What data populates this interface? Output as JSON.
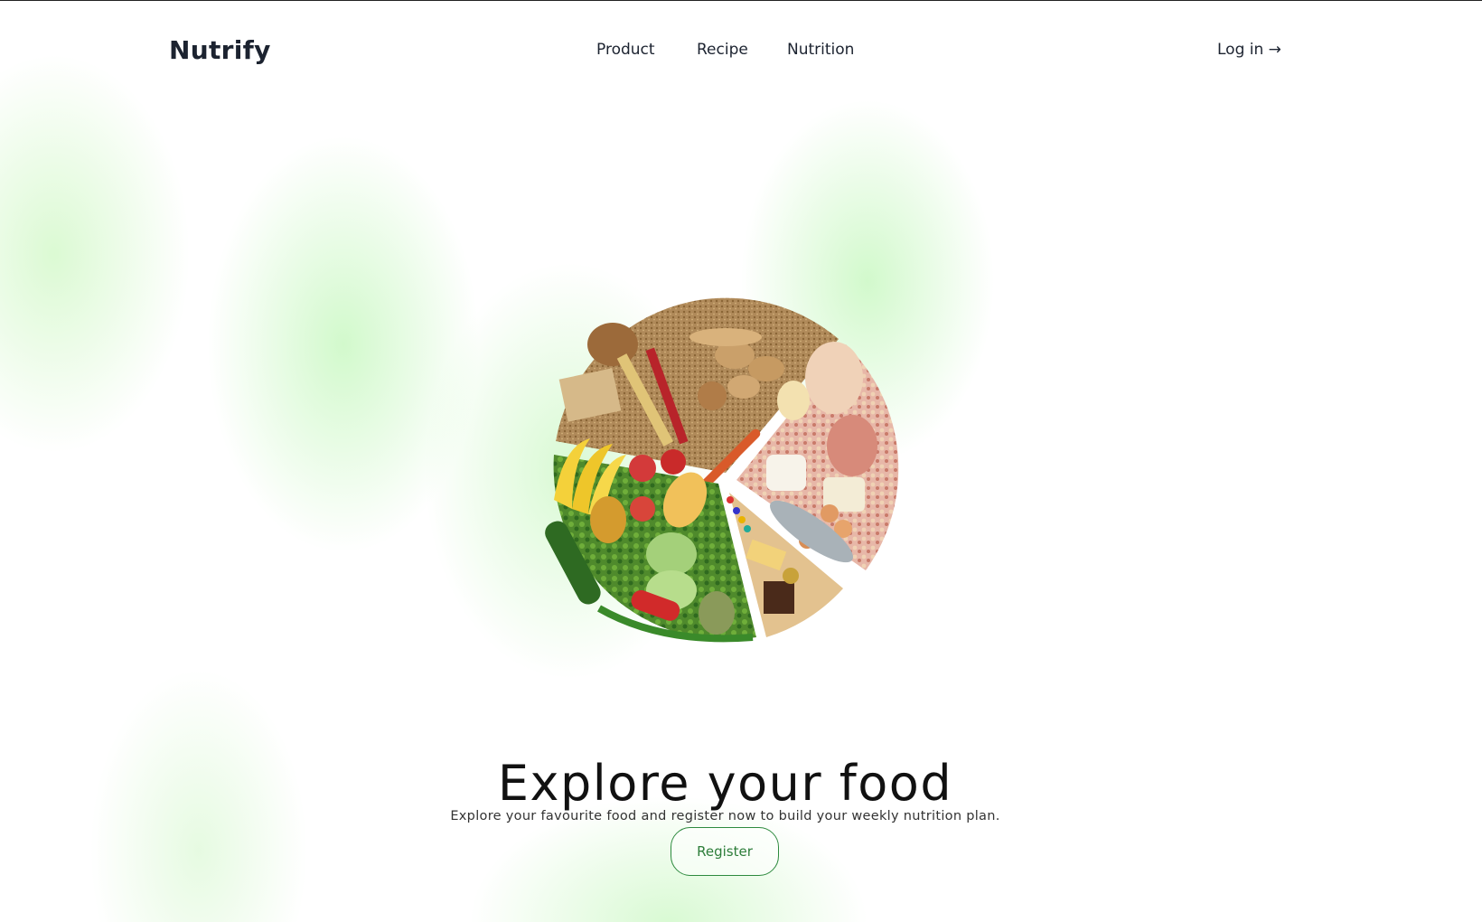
{
  "brand": {
    "name": "Nutrify"
  },
  "nav": {
    "items": [
      {
        "label": "Product"
      },
      {
        "label": "Recipe"
      },
      {
        "label": "Nutrition"
      }
    ],
    "login_label": "Log in →"
  },
  "hero": {
    "image_alt": "pie-chart-of-food-groups",
    "title": "Explore your food",
    "subtitle": "Explore your favourite food and register now to build your weekly nutrition plan.",
    "cta_label": "Register"
  },
  "colors": {
    "accent_green": "#2d8a3e",
    "glow_green": "#bef5af",
    "text_dark": "#1c2330"
  }
}
